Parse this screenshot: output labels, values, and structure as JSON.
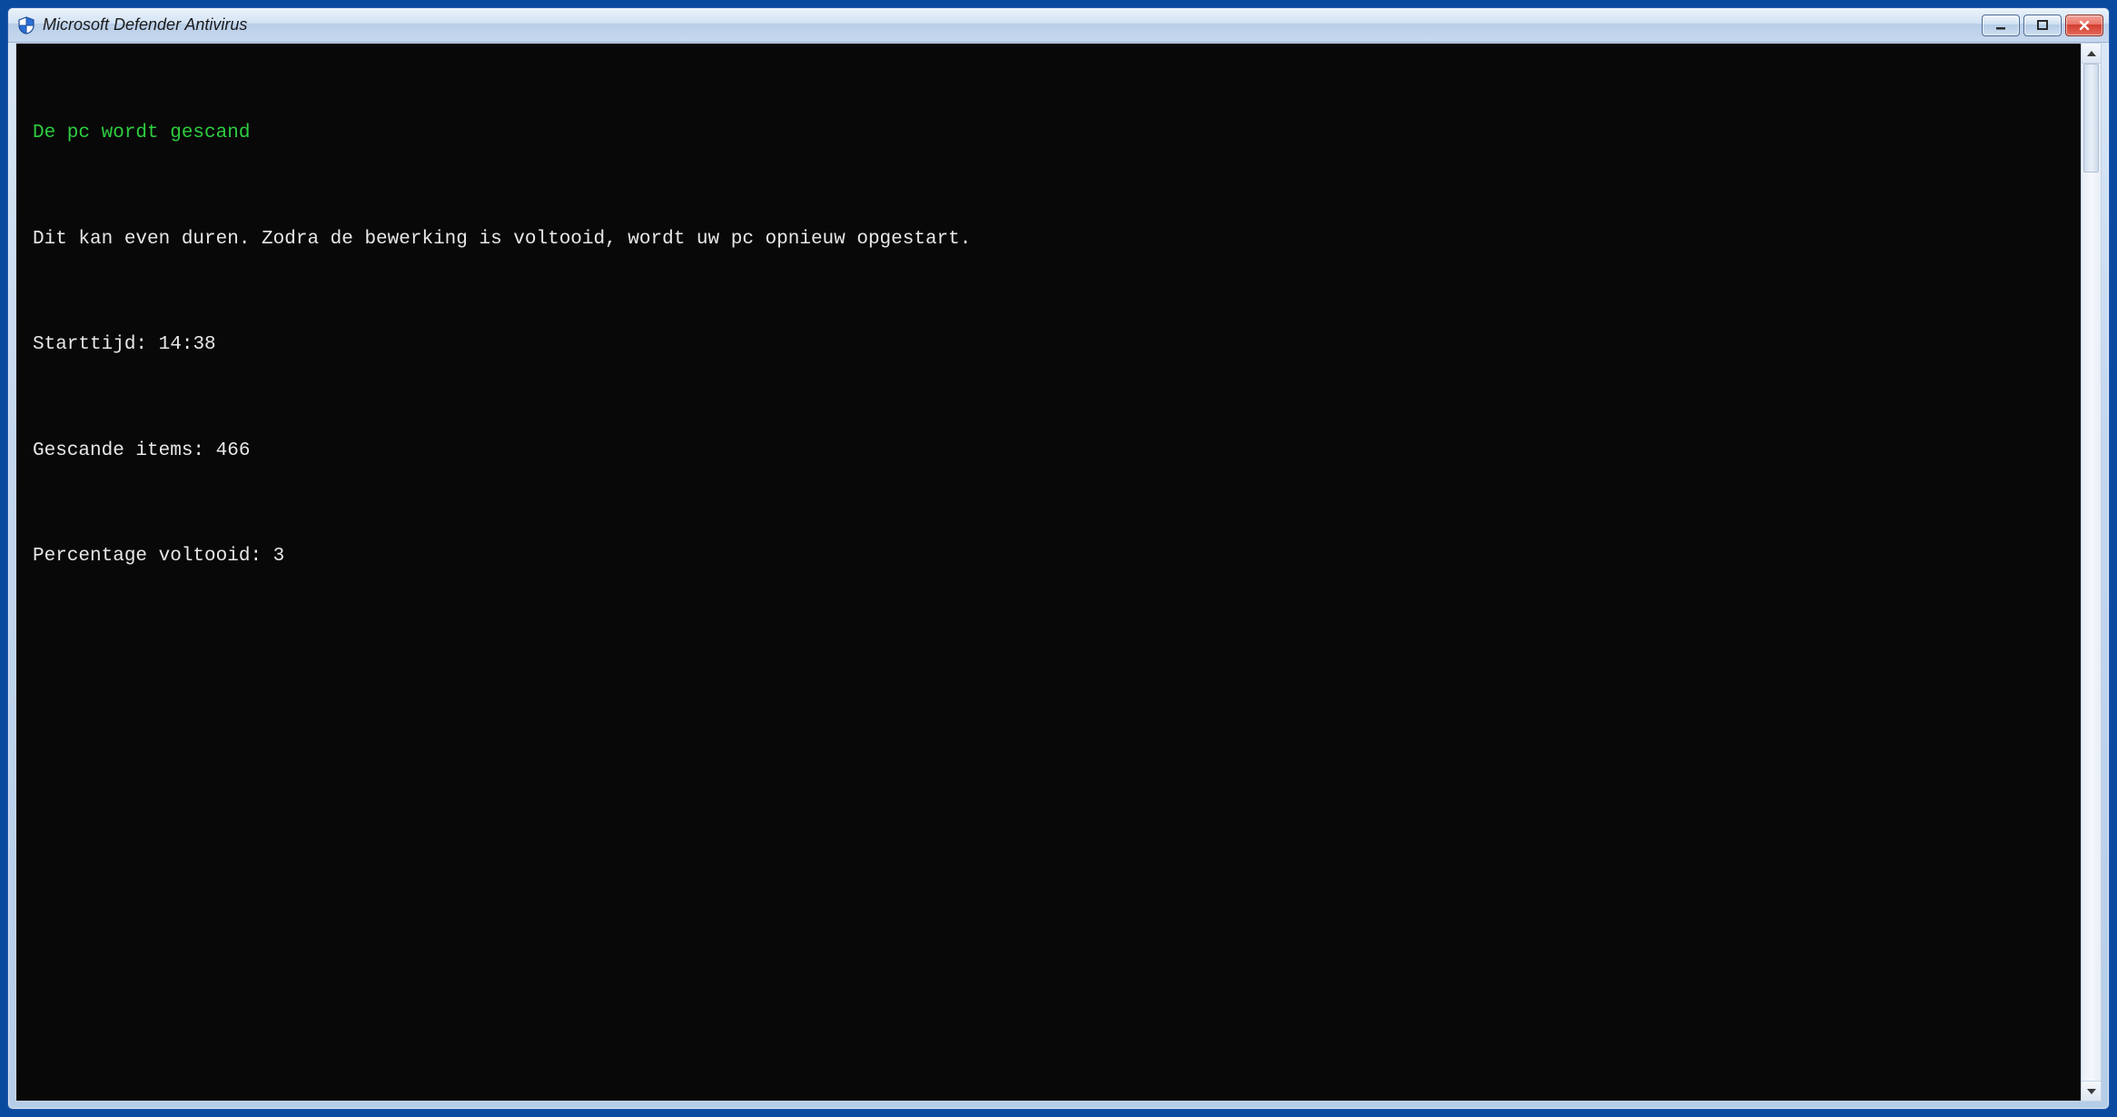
{
  "window": {
    "title": "Microsoft Defender Antivirus"
  },
  "console": {
    "heading": "De pc wordt gescand",
    "subtext": "Dit kan even duren. Zodra de bewerking is voltooid, wordt uw pc opnieuw opgestart.",
    "start_label": "Starttijd:",
    "start_value": "14:38",
    "scanned_label": "Gescande items:",
    "scanned_value": "466",
    "percent_label": "Percentage voltooid:",
    "percent_value": "3"
  },
  "colors": {
    "heading_green": "#2ecc40",
    "console_bg": "#080808",
    "console_fg": "#e8e8e8"
  }
}
